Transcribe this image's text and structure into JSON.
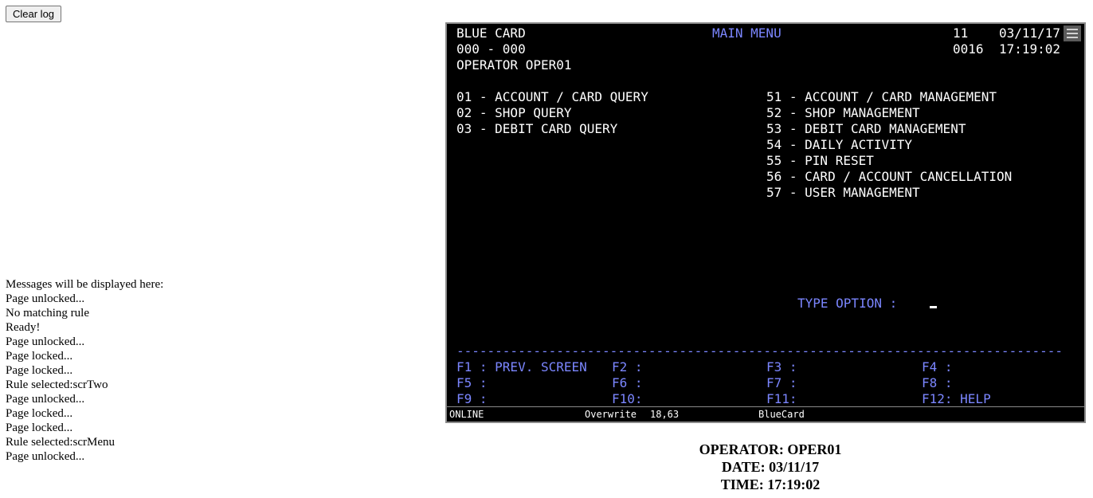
{
  "clear_button": {
    "label": "Clear log"
  },
  "log": {
    "lines": [
      "Messages will be displayed here:",
      "Page unlocked...",
      "No matching rule",
      "Ready!",
      "Page unlocked...",
      "Page locked...",
      "Page locked...",
      "Rule selected:scrTwo",
      "Page unlocked...",
      "Page locked...",
      "Page locked...",
      "Rule selected:scrMenu",
      "Page unlocked..."
    ]
  },
  "terminal": {
    "header": {
      "app": "BLUE CARD",
      "title": "MAIN MENU",
      "code": "11",
      "date": "03/11/17",
      "range": "000 - 000",
      "number": "0016",
      "time": "17:19:02",
      "operator": "OPERATOR OPER01"
    },
    "menu_left": [
      "01 - ACCOUNT / CARD QUERY",
      "02 - SHOP QUERY",
      "03 - DEBIT CARD QUERY"
    ],
    "menu_right": [
      "51 - ACCOUNT / CARD MANAGEMENT",
      "52 - SHOP MANAGEMENT",
      "53 - DEBIT CARD MANAGEMENT",
      "54 - DAILY ACTIVITY",
      "55 - PIN RESET",
      "56 - CARD / ACCOUNT CANCELLATION",
      "57 - USER MANAGEMENT"
    ],
    "prompt": "TYPE OPTION :",
    "separator": "-------------------------------------------------------------------------------",
    "fkeys": [
      [
        "F1 : PREV. SCREEN",
        "F2 :",
        "F3 :",
        "F4 :"
      ],
      [
        "F5 :",
        "F6 :",
        "F7 :",
        "F8 :"
      ],
      [
        "F9 :",
        "F10:",
        "F11:",
        "F12: HELP"
      ]
    ],
    "status": {
      "mode": "ONLINE",
      "insert": "Overwrite",
      "cursor": "18,63",
      "session": "BlueCard"
    },
    "colors": {
      "background": "#000000",
      "text": "#ffffff",
      "accent": "#7b86ff"
    }
  },
  "info": {
    "operator": "OPERATOR: OPER01",
    "date": "DATE: 03/11/17",
    "time": "TIME: 17:19:02"
  }
}
